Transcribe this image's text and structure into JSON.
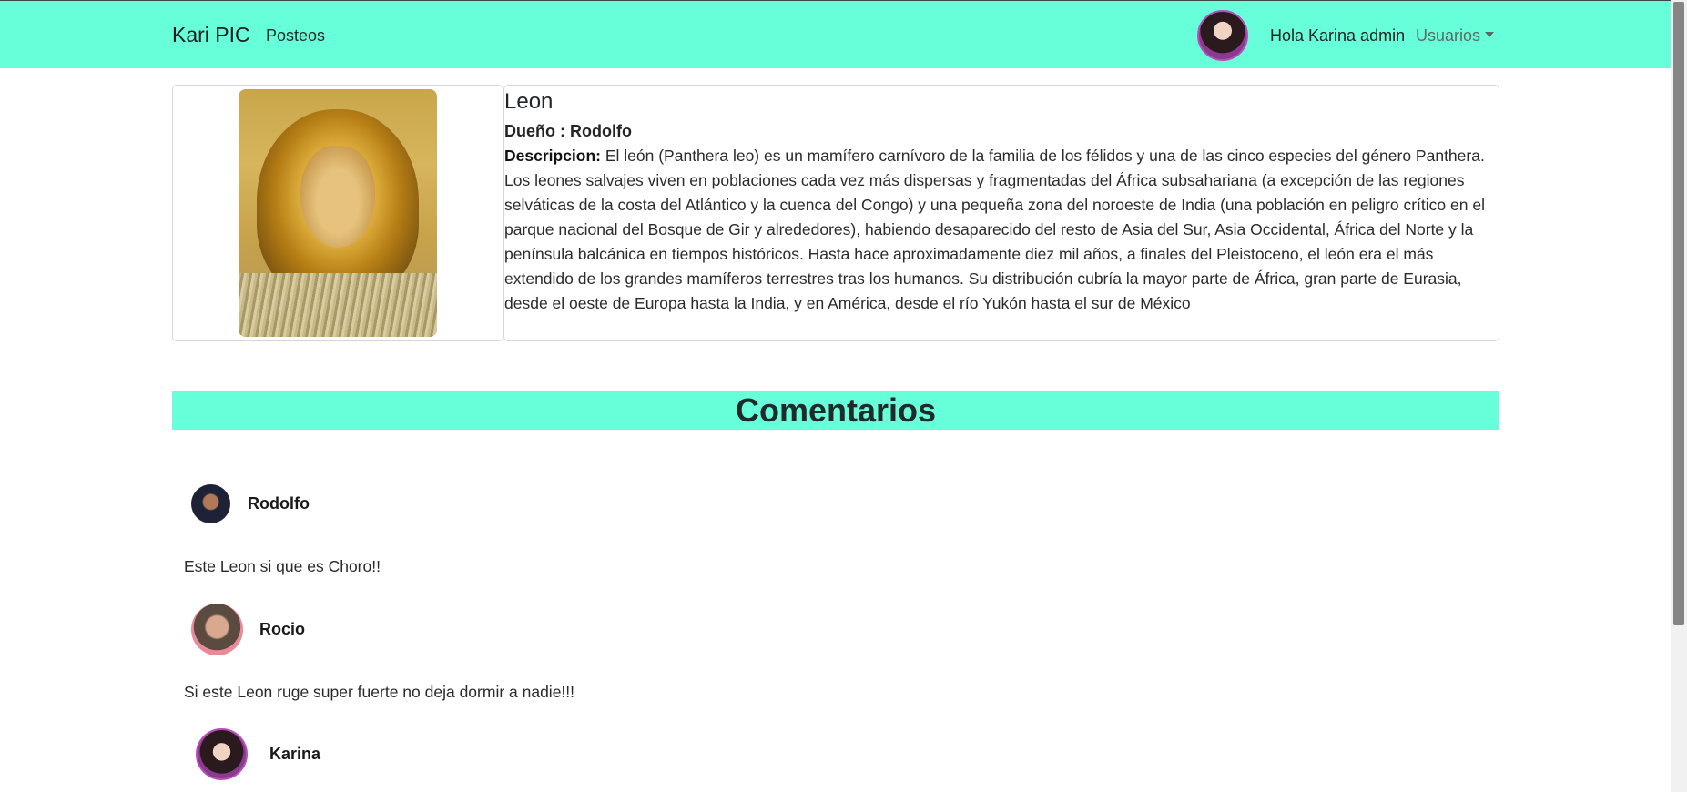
{
  "navbar": {
    "brand": "Kari PIC",
    "link_posts": "Posteos",
    "greeting": "Hola Karina admin",
    "users_dropdown": "Usuarios"
  },
  "post": {
    "title": "Leon",
    "owner_label": "Dueño : Rodolfo",
    "description_label": "Descripcion:",
    "description": " El león (Panthera leo) es un mamífero carnívoro de la familia de los félidos y una de las cinco especies del género Panthera. Los leones salvajes viven en poblaciones cada vez más dispersas y fragmentadas del África subsahariana (a excepción de las regiones selváticas de la costa del Atlántico y la cuenca del Congo) y una pequeña zona del noroeste de India (una población en peligro crítico en el parque nacional del Bosque de Gir y alrededores), habiendo desaparecido del resto de Asia del Sur, Asia Occidental, África del Norte y la península balcánica en tiempos históricos. Hasta hace aproximadamente diez mil años, a finales del Pleistoceno, el león era el más extendido de los grandes mamíferos terrestres tras los humanos. Su distribución cubría la mayor parte de África, gran parte de Eurasia, desde el oeste de Europa hasta la India, y en América, desde el río Yukón hasta el sur de México"
  },
  "comments": {
    "heading": "Comentarios",
    "items": [
      {
        "user": "Rodolfo",
        "text": "Este Leon si que es Choro!!"
      },
      {
        "user": "Rocio",
        "text": "Si este Leon ruge super fuerte no deja dormir a nadie!!!"
      },
      {
        "user": "Karina",
        "text": ""
      }
    ]
  },
  "colors": {
    "accent": "#66ffd9"
  }
}
